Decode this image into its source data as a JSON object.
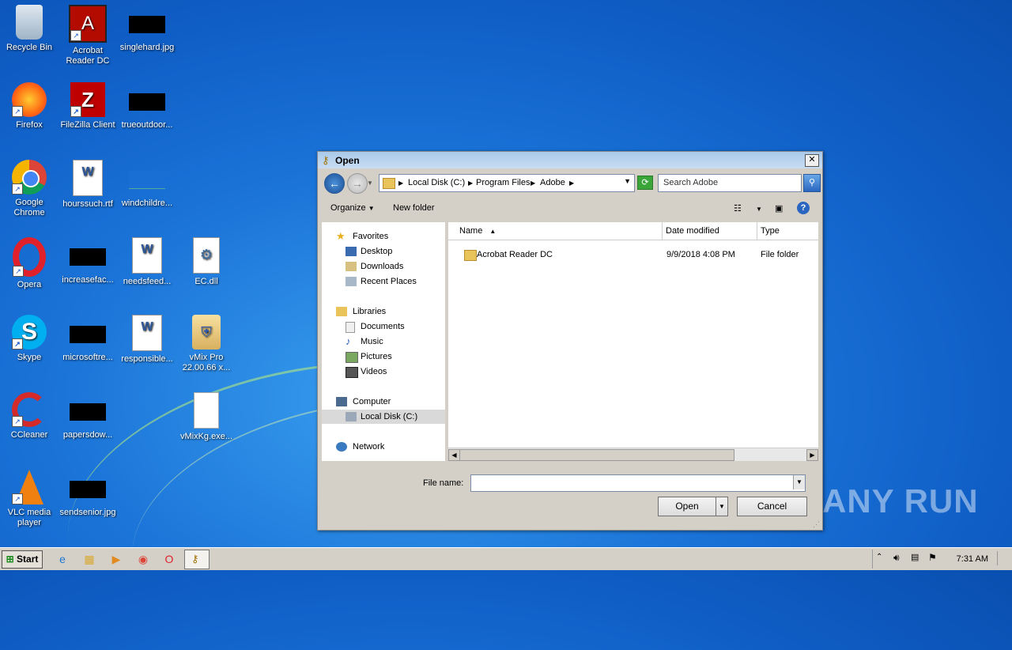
{
  "desktop": {
    "icons": [
      {
        "label": "Recycle Bin"
      },
      {
        "label": "Acrobat Reader DC"
      },
      {
        "label": "singlehard.jpg"
      },
      {
        "label": "Firefox"
      },
      {
        "label": "FileZilla Client"
      },
      {
        "label": "trueoutdoor..."
      },
      {
        "label": "Google Chrome"
      },
      {
        "label": "hourssuch.rtf"
      },
      {
        "label": "windchildre..."
      },
      {
        "label": "Opera"
      },
      {
        "label": "increasefac..."
      },
      {
        "label": "needsfeed..."
      },
      {
        "label": "EC.dll"
      },
      {
        "label": "Skype"
      },
      {
        "label": "microsoftre..."
      },
      {
        "label": "responsible..."
      },
      {
        "label": "vMix Pro 22.00.66 x..."
      },
      {
        "label": "CCleaner"
      },
      {
        "label": "papersdow..."
      },
      {
        "label": "vMixKg.exe..."
      },
      {
        "label": "VLC media player"
      },
      {
        "label": "sendsenior.jpg"
      }
    ],
    "watermark": "ANY RUN"
  },
  "dialog": {
    "title": "Open",
    "close": "✕",
    "address": {
      "crumbs": [
        "Local Disk (C:)",
        "Program Files",
        "Adobe"
      ]
    },
    "search_placeholder": "Search Adobe",
    "toolbar": {
      "organize": "Organize",
      "new_folder": "New folder"
    },
    "nav": {
      "favorites": "Favorites",
      "desktop": "Desktop",
      "downloads": "Downloads",
      "recent_places": "Recent Places",
      "libraries": "Libraries",
      "documents": "Documents",
      "music": "Music",
      "pictures": "Pictures",
      "videos": "Videos",
      "computer": "Computer",
      "local_disk": "Local Disk (C:)",
      "network": "Network"
    },
    "columns": {
      "name": "Name",
      "date_modified": "Date modified",
      "type": "Type"
    },
    "files": [
      {
        "name": "Acrobat Reader DC",
        "date": "9/9/2018 4:08 PM",
        "type": "File folder"
      }
    ],
    "file_name_label": "File name:",
    "file_name_value": "",
    "open_button": "Open",
    "cancel_button": "Cancel"
  },
  "taskbar": {
    "start": "Start",
    "clock": "7:31 AM"
  }
}
